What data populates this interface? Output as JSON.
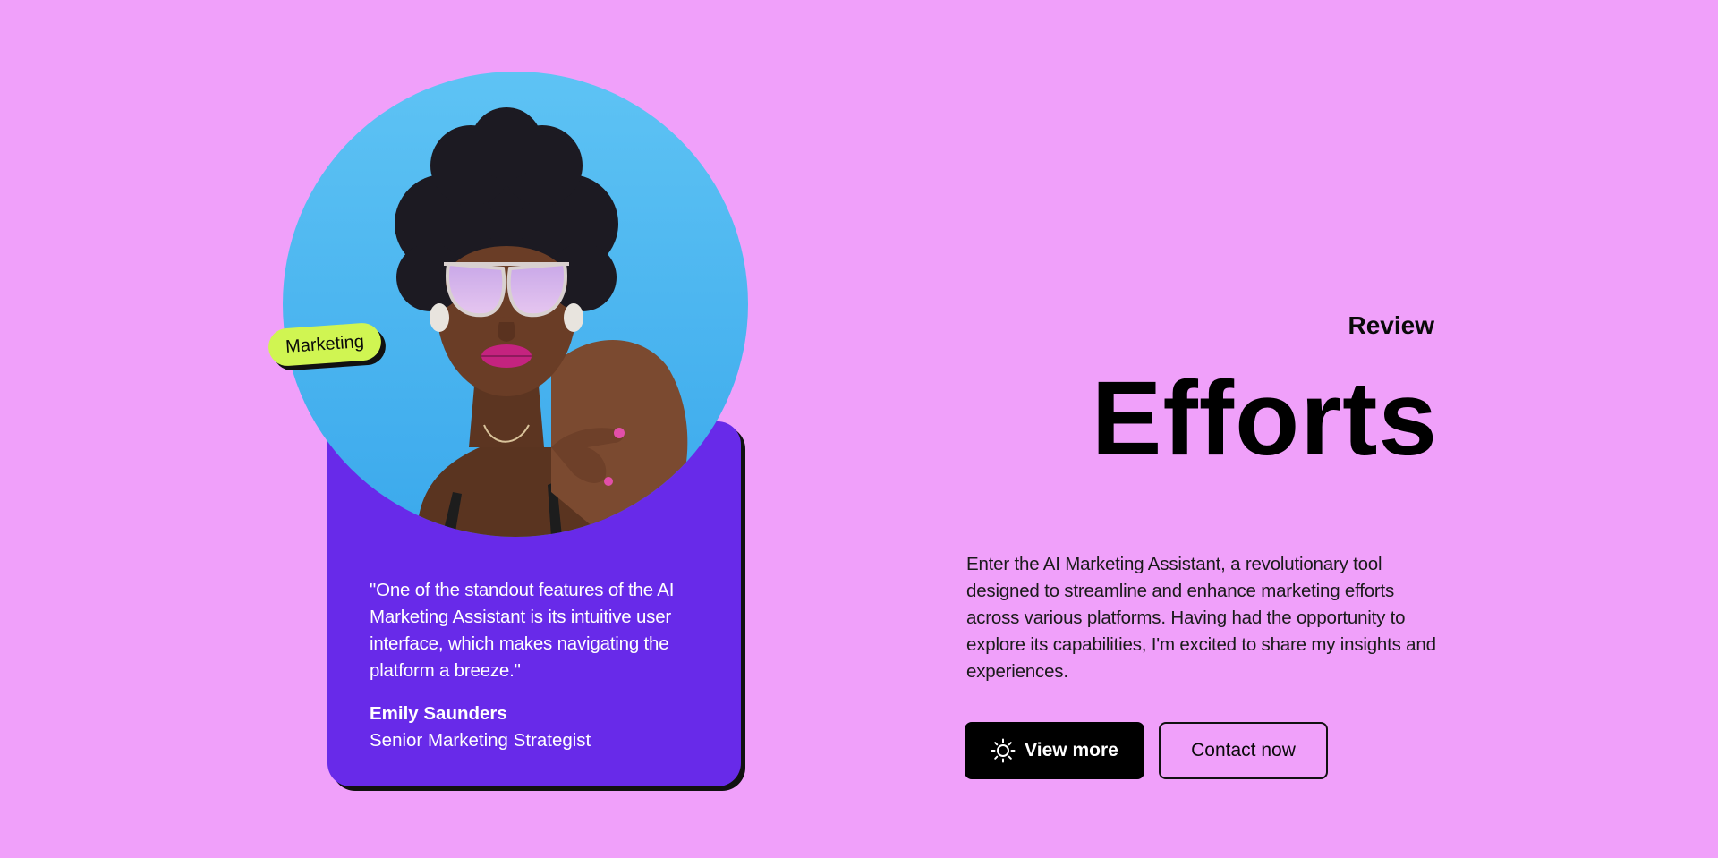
{
  "testimonial": {
    "tag": "Marketing",
    "quote": "\"One of the standout features of the AI Marketing Assistant is its intuitive user interface, which makes navigating the platform a breeze.\"",
    "author_name": "Emily Saunders",
    "author_role": "Senior Marketing Strategist",
    "photo_icon": "person-portrait-photo"
  },
  "hero": {
    "eyebrow": "Review",
    "title": "Efforts",
    "description": "Enter the AI Marketing Assistant, a revolutionary tool designed to streamline and enhance marketing efforts across various platforms. Having had the opportunity to explore its capabilities, I'm excited to share my insights and experiences."
  },
  "actions": {
    "primary_label": "View more",
    "primary_icon": "sun-icon",
    "secondary_label": "Contact now"
  },
  "colors": {
    "background": "#F0A0FA",
    "card": "#682AE9",
    "tag": "#D0F552",
    "primary_button": "#000000"
  }
}
